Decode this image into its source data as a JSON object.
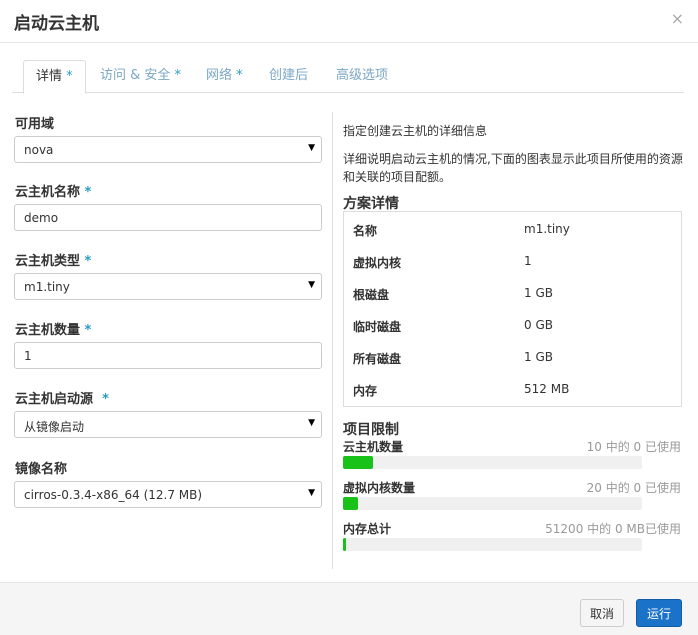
{
  "dialog": {
    "title": "启动云主机",
    "close": "×"
  },
  "tabs": [
    {
      "label": "详情",
      "required": " *"
    },
    {
      "label": "访问 & 安全",
      "required": " *"
    },
    {
      "label": "网络",
      "required": " *"
    },
    {
      "label": "创建后",
      "required": ""
    },
    {
      "label": "高级选项",
      "required": ""
    }
  ],
  "form": {
    "availability_zone": {
      "label": "可用域",
      "required": "",
      "value": "nova"
    },
    "instance_name": {
      "label": "云主机名称",
      "required": " *",
      "value": "demo"
    },
    "flavor": {
      "label": "云主机类型",
      "required": " *",
      "value": "m1.tiny"
    },
    "instance_count": {
      "label": "云主机数量",
      "required": " *",
      "value": "1"
    },
    "boot_source": {
      "label": "云主机启动源",
      "required": "  *",
      "value": "从镜像启动"
    },
    "image_name": {
      "label": "镜像名称",
      "required": "",
      "value": "cirros-0.3.4-x86_64 (12.7 MB)"
    }
  },
  "info": {
    "intro": "指定创建云主机的详细信息",
    "description": "详细说明启动云主机的情况,下面的图表显示此项目所使用的资源和关联的项目配额。"
  },
  "flavor_details": {
    "heading": "方案详情",
    "rows": [
      {
        "key": "名称",
        "value": "m1.tiny"
      },
      {
        "key": "虚拟内核",
        "value": "1"
      },
      {
        "key": "根磁盘",
        "value": "1 GB"
      },
      {
        "key": "临时磁盘",
        "value": "0 GB"
      },
      {
        "key": "所有磁盘",
        "value": "1 GB"
      },
      {
        "key": "内存",
        "value": "512 MB"
      }
    ]
  },
  "limits": {
    "heading": "项目限制",
    "items": [
      {
        "label": "云主机数量",
        "text": "10 中的 0 已使用",
        "fill_fraction": 0.1
      },
      {
        "label": "虚拟内核数量",
        "text": "20 中的 0 已使用",
        "fill_fraction": 0.05
      },
      {
        "label": "内存总计",
        "text": "51200 中的 0 MB已使用",
        "fill_fraction": 0.01
      }
    ]
  },
  "footer": {
    "cancel": "取消",
    "run": "运行"
  },
  "colors": {
    "accent": "#2a9ac4",
    "primary_button": "#1a73c9",
    "quota_fill": "#19c219"
  }
}
